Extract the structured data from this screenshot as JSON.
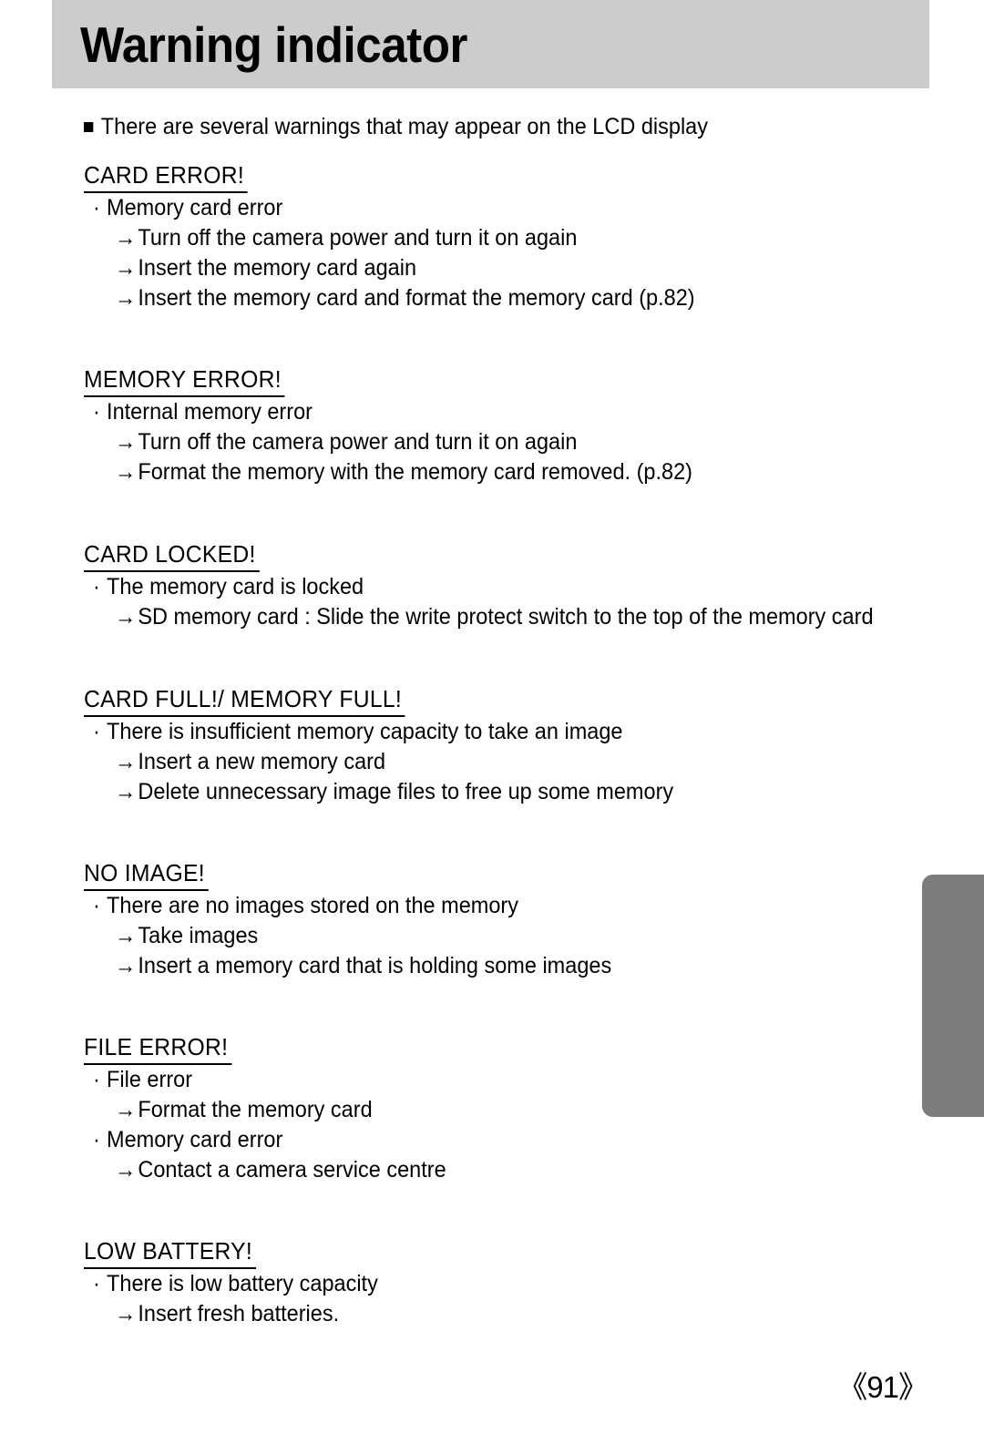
{
  "header": {
    "title": "Warning indicator",
    "background_color": "#cccccc"
  },
  "edge_tab": {
    "color": "#7c7c7c"
  },
  "intro": {
    "bullet": "square-bullet",
    "text": "There are several warnings that may appear on the LCD display"
  },
  "sections": [
    {
      "title": "CARD ERROR!",
      "items": [
        {
          "marker": "·",
          "text": "Memory card error"
        }
      ],
      "actions": [
        "Turn off the camera power and turn it on again",
        "Insert the memory card again",
        "Insert the memory card and format the memory card (p.82)"
      ]
    },
    {
      "title": "MEMORY ERROR!",
      "items": [
        {
          "marker": "·",
          "text": "Internal memory error"
        }
      ],
      "actions": [
        "Turn off the camera power and turn it on again",
        "Format the memory with the memory card removed. (p.82)"
      ]
    },
    {
      "title": "CARD LOCKED!",
      "items": [
        {
          "marker": "·",
          "text": "The memory card is locked"
        }
      ],
      "actions": [
        "SD memory card : Slide the write protect switch to the top of the memory card"
      ]
    },
    {
      "title": "CARD FULL!/ MEMORY FULL!",
      "items": [
        {
          "marker": "·",
          "text": "There is insufficient memory capacity to take an image"
        }
      ],
      "actions": [
        "Insert a new memory card",
        "Delete unnecessary image files to free up some memory"
      ]
    },
    {
      "title": "NO IMAGE!",
      "items": [
        {
          "marker": "·",
          "text": "There are no images stored on the memory"
        }
      ],
      "actions": [
        "Take images",
        "Insert a memory card that is holding some images"
      ]
    },
    {
      "title": "FILE ERROR!",
      "items": [
        {
          "marker": "·",
          "text": "File error"
        }
      ],
      "actions": [
        "Format the memory card"
      ],
      "items2": [
        {
          "marker": "·",
          "text": "Memory card error"
        }
      ],
      "actions2": [
        "Contact a camera service centre"
      ]
    },
    {
      "title": "LOW BATTERY!",
      "items": [
        {
          "marker": "·",
          "text": "There is low battery capacity"
        }
      ],
      "actions": [
        "Insert fresh batteries."
      ]
    }
  ],
  "footer": {
    "page_number": "《91》"
  },
  "glyphs": {
    "arrow": "→"
  }
}
